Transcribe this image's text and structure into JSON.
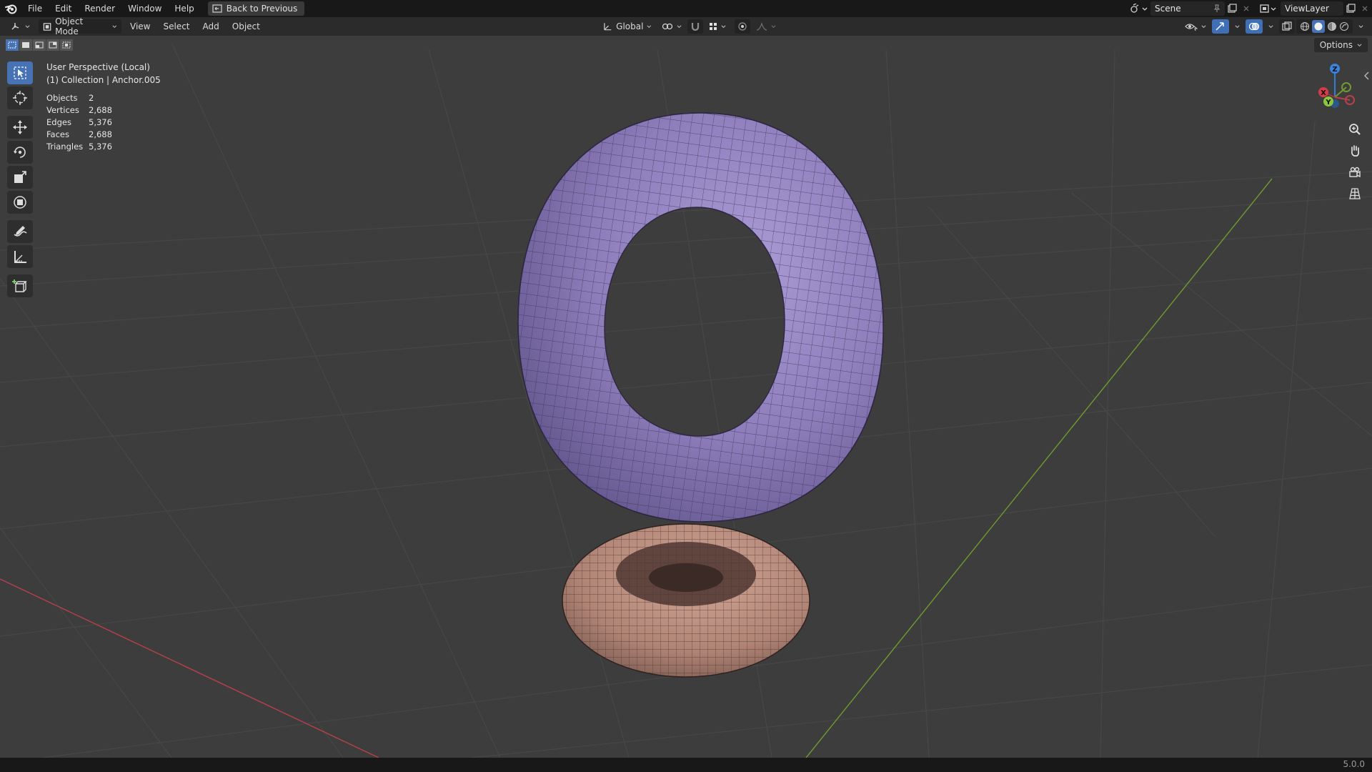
{
  "menubar": {
    "items": [
      "File",
      "Edit",
      "Render",
      "Window",
      "Help"
    ],
    "back_button": "Back to Previous",
    "scene": "Scene",
    "view_layer": "ViewLayer"
  },
  "header": {
    "mode": "Object Mode",
    "menus": [
      "View",
      "Select",
      "Add",
      "Object"
    ],
    "transform_orientation": "Global",
    "options_label": "Options"
  },
  "viewport": {
    "perspective_label": "User Perspective (Local)",
    "collection_label": "(1) Collection | Anchor.005",
    "stats": [
      {
        "label": "Objects",
        "value": "2"
      },
      {
        "label": "Vertices",
        "value": "2,688"
      },
      {
        "label": "Edges",
        "value": "5,376"
      },
      {
        "label": "Faces",
        "value": "2,688"
      },
      {
        "label": "Triangles",
        "value": "5,376"
      }
    ],
    "objects": [
      {
        "name": "purple-torus",
        "color": "#8f7fb8"
      },
      {
        "name": "pink-torus",
        "color": "#b58a7d"
      }
    ],
    "axis_colors": {
      "x": "#d63c48",
      "y": "#7fb33a",
      "z": "#2f7fd8"
    },
    "gizmo_labels": {
      "z": "Z",
      "y": "Y",
      "x": "X"
    }
  },
  "tools": [
    "select-box",
    "cursor",
    "move",
    "rotate",
    "scale",
    "transform",
    "annotate",
    "measure",
    "add-cube"
  ],
  "status": {
    "version": "5.0.0"
  }
}
